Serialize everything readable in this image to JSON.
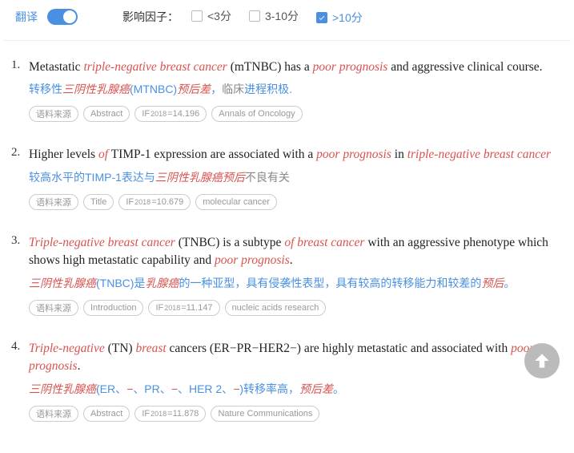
{
  "topbar": {
    "translate_label": "翻译",
    "factor_label": "影响因子：",
    "options": [
      {
        "text": "<3分",
        "checked": false
      },
      {
        "text": "3-10分",
        "checked": false
      },
      {
        "text": ">10分",
        "checked": true
      }
    ]
  },
  "results": [
    {
      "num": "1.",
      "en_parts": [
        {
          "t": "Metastatic "
        },
        {
          "t": "triple",
          "hl": true
        },
        {
          "t": "-",
          "hl": true
        },
        {
          "t": "negative breast cancer",
          "hl": true
        },
        {
          "t": " (mTNBC) has a "
        },
        {
          "t": "poor prognosis",
          "hl": true
        },
        {
          "t": " and aggressive clinical course."
        }
      ],
      "zh_parts": [
        {
          "t": "转移性"
        },
        {
          "t": "三阴性乳腺癌",
          "cls": "r"
        },
        {
          "t": "(MTNBC)"
        },
        {
          "t": "预后差",
          "cls": "r"
        },
        {
          "t": "，"
        },
        {
          "t": "临床",
          "cls": "g"
        },
        {
          "t": "进程积极."
        }
      ],
      "tags": {
        "src": "语料来源",
        "section": "Abstract",
        "if_year": "2018",
        "if_val": "=14.196",
        "journal": "Annals of Oncology"
      }
    },
    {
      "num": "2.",
      "en_parts": [
        {
          "t": "Higher levels "
        },
        {
          "t": "of",
          "hl": true
        },
        {
          "t": " TIMP-1 expression are associated with a "
        },
        {
          "t": "poor prognosis",
          "hl": true
        },
        {
          "t": " in "
        },
        {
          "t": "triple",
          "hl": true
        },
        {
          "t": "-",
          "hl": true
        },
        {
          "t": "negative breast cancer",
          "hl": true
        }
      ],
      "zh_parts": [
        {
          "t": "较高水平的TIMP-1表达与"
        },
        {
          "t": "三阴性乳腺癌预后",
          "cls": "r"
        },
        {
          "t": "不良有关",
          "cls": "g"
        }
      ],
      "tags": {
        "src": "语料来源",
        "section": "Title",
        "if_year": "2018",
        "if_val": "=10.679",
        "journal": "molecular cancer"
      }
    },
    {
      "num": "3.",
      "en_parts": [
        {
          "t": "Triple",
          "hl": true
        },
        {
          "t": "-",
          "hl": true
        },
        {
          "t": "negative breast cancer",
          "hl": true
        },
        {
          "t": " (TNBC) is a subtype "
        },
        {
          "t": "of breast cancer",
          "hl": true
        },
        {
          "t": " with an aggressive phenotype which shows high metastatic capability and "
        },
        {
          "t": "poor prognosis",
          "hl": true
        },
        {
          "t": "."
        }
      ],
      "zh_parts": [
        {
          "t": "三阴性乳腺癌",
          "cls": "r"
        },
        {
          "t": "(TNBC)是"
        },
        {
          "t": "乳腺癌",
          "cls": "r"
        },
        {
          "t": "的一种亚型，具有侵袭性表型，具有较高的转移能力和较差的"
        },
        {
          "t": "预后",
          "cls": "r"
        },
        {
          "t": "。"
        }
      ],
      "tags": {
        "src": "语料来源",
        "section": "Introduction",
        "if_year": "2018",
        "if_val": "=11.147",
        "journal": "nucleic acids research"
      }
    },
    {
      "num": "4.",
      "en_parts": [
        {
          "t": "Triple",
          "hl": true
        },
        {
          "t": "-",
          "hl": true
        },
        {
          "t": "negative",
          "hl": true
        },
        {
          "t": " (TN) "
        },
        {
          "t": "breast",
          "hl": true
        },
        {
          "t": " cancers (ER−PR−HER2−) are highly metastatic and associated with "
        },
        {
          "t": "poor prognosis",
          "hl": true
        },
        {
          "t": "."
        }
      ],
      "zh_parts": [
        {
          "t": "三阴性乳腺癌",
          "cls": "r"
        },
        {
          "t": "(ER、"
        },
        {
          "t": "−",
          "cls": "r"
        },
        {
          "t": "、PR、"
        },
        {
          "t": "−",
          "cls": "r"
        },
        {
          "t": "、HER 2、"
        },
        {
          "t": "−",
          "cls": "r"
        },
        {
          "t": ")转移率高，"
        },
        {
          "t": "预后差",
          "cls": "r"
        },
        {
          "t": "。"
        }
      ],
      "tags": {
        "src": "语料来源",
        "section": "Abstract",
        "if_year": "2018",
        "if_val": "=11.878",
        "journal": "Nature Communications"
      }
    }
  ]
}
